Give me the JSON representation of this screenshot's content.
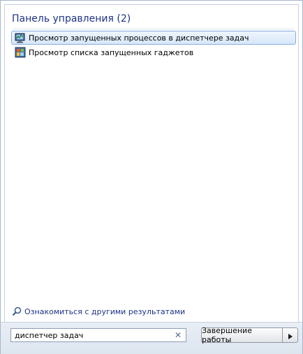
{
  "results": {
    "header": "Панель управления (2)",
    "items": [
      {
        "label": "Просмотр запущенных процессов в диспетчере задач",
        "icon": "task-manager-icon",
        "selected": true
      },
      {
        "label": "Просмотр списка запущенных гаджетов",
        "icon": "gadgets-icon",
        "selected": false
      }
    ],
    "more_link": "Ознакомиться с другими результатами",
    "more_icon": "magnifier-icon"
  },
  "search": {
    "value": "диспетчер задач",
    "clear_icon": "close-icon"
  },
  "shutdown": {
    "label": "Завершение работы",
    "arrow_icon": "triangle-right-icon"
  },
  "colors": {
    "header_text": "#1e3287",
    "selection_border": "#84acdd",
    "bottom_bar": "#e3e9f1"
  }
}
